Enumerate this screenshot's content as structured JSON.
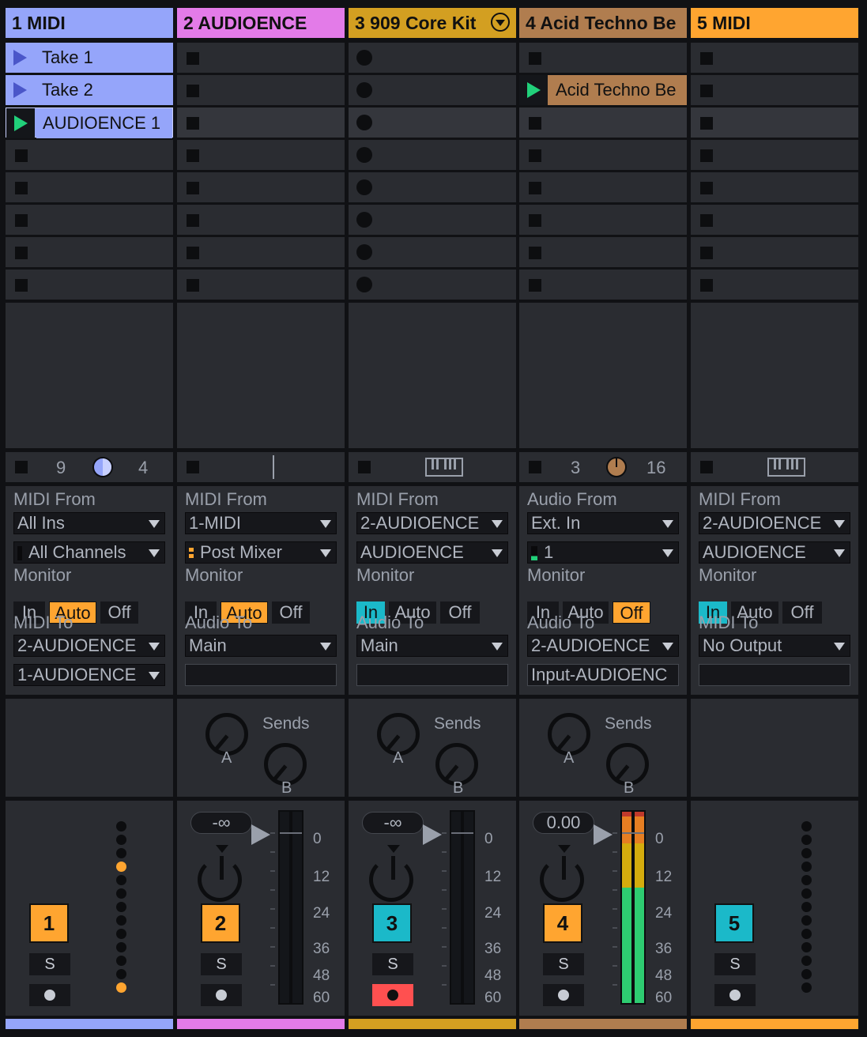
{
  "tracks": [
    {
      "title": "1 MIDI",
      "color": "#95a5fa",
      "clips": [
        {
          "slot": 0,
          "label": "Take 1",
          "state": "stopped"
        },
        {
          "slot": 1,
          "label": "Take 2",
          "state": "stopped"
        },
        {
          "slot": 2,
          "label": "AUDIOENCE 1",
          "state": "playing"
        }
      ],
      "status": {
        "left": "9",
        "right": "4"
      },
      "io": {
        "from_label": "MIDI From",
        "from": "All Ins",
        "from_sub": "All Channels",
        "monitor_label": "Monitor",
        "monitor": [
          "In",
          "Auto",
          "Off"
        ],
        "monitor_active": "Auto",
        "to_label": "MIDI To",
        "to": "2-AUDIOENCE",
        "to_sub": "1-AUDIOENCE"
      },
      "number": "1",
      "solo": "S",
      "volume": ""
    },
    {
      "title": "2 AUDIOENCE",
      "color": "#e37be8",
      "clips": [],
      "io": {
        "from_label": "MIDI From",
        "from": "1-MIDI",
        "from_sub": "Post Mixer",
        "monitor_label": "Monitor",
        "monitor": [
          "In",
          "Auto",
          "Off"
        ],
        "monitor_active": "Auto",
        "to_label": "Audio To",
        "to": "Main",
        "to_sub": ""
      },
      "sends_label": "Sends",
      "send_a": "A",
      "send_b": "B",
      "number": "2",
      "solo": "S",
      "volume": "-∞",
      "scale": [
        "0",
        "12",
        "24",
        "36",
        "48",
        "60"
      ]
    },
    {
      "title": "3 909 Core Kit",
      "color": "#d39f21",
      "clips": [],
      "io": {
        "from_label": "MIDI From",
        "from": "2-AUDIOENCE",
        "from_sub": "AUDIOENCE",
        "monitor_label": "Monitor",
        "monitor": [
          "In",
          "Auto",
          "Off"
        ],
        "monitor_active": "In",
        "to_label": "Audio To",
        "to": "Main",
        "to_sub": ""
      },
      "sends_label": "Sends",
      "send_a": "A",
      "send_b": "B",
      "number": "3",
      "solo": "S",
      "volume": "-∞",
      "scale": [
        "0",
        "12",
        "24",
        "36",
        "48",
        "60"
      ]
    },
    {
      "title": "4 Acid Techno Be",
      "color": "#b07d4f",
      "clips": [
        {
          "slot": 1,
          "label": "Acid Techno Be",
          "state": "playing"
        }
      ],
      "status": {
        "left": "3",
        "right": "16"
      },
      "io": {
        "from_label": "Audio From",
        "from": "Ext. In",
        "from_sub": "1",
        "monitor_label": "Monitor",
        "monitor": [
          "In",
          "Auto",
          "Off"
        ],
        "monitor_active": "Off",
        "to_label": "Audio To",
        "to": "2-AUDIOENCE",
        "to_sub": "Input-AUDIOENC"
      },
      "sends_label": "Sends",
      "send_a": "A",
      "send_b": "B",
      "number": "4",
      "solo": "S",
      "volume": "0.00",
      "scale": [
        "0",
        "12",
        "24",
        "36",
        "48",
        "60"
      ]
    },
    {
      "title": "5 MIDI",
      "color": "#ffa530",
      "clips": [],
      "io": {
        "from_label": "MIDI From",
        "from": "2-AUDIOENCE",
        "from_sub": "AUDIOENCE",
        "monitor_label": "Monitor",
        "monitor": [
          "In",
          "Auto",
          "Off"
        ],
        "monitor_active": "In",
        "to_label": "MIDI To",
        "to": "No Output",
        "to_sub": ""
      },
      "number": "5",
      "solo": "S",
      "volume": ""
    }
  ],
  "colors": {
    "orange": "#ffa530",
    "cyan": "#1bb9c9",
    "green": "#21d07a",
    "arm_red": "#ff5050"
  }
}
